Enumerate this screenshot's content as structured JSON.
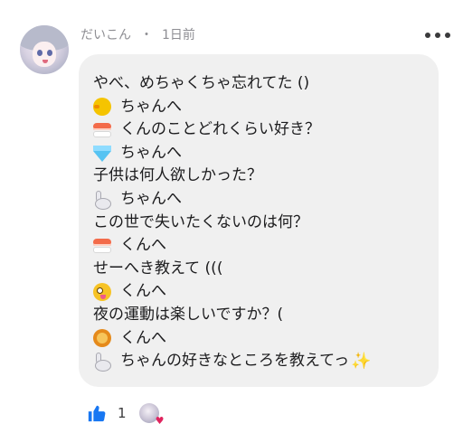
{
  "comment": {
    "author": "だいこん",
    "separator": "・",
    "timestamp": "1日前",
    "lines": [
      {
        "icon": "",
        "text": "やべ、めちゃくちゃ忘れてた ()"
      },
      {
        "icon": "chick-icon",
        "text": "ちゃんへ"
      },
      {
        "icon": "sushi-icon",
        "text": "くんのことどれくらい好き？"
      },
      {
        "icon": "gem-icon",
        "text": "ちゃんへ"
      },
      {
        "icon": "",
        "text": "子供は何人欲しかった？"
      },
      {
        "icon": "rabbit-icon",
        "text": "ちゃんへ"
      },
      {
        "icon": "",
        "text": "この世で失いたくないのは何？"
      },
      {
        "icon": "sushi-icon",
        "text": "くんへ"
      },
      {
        "icon": "",
        "text": "せーへき教えて (((",
        "note": ""
      },
      {
        "icon": "zany-face-icon",
        "text": "くんへ"
      },
      {
        "icon": "",
        "text": "夜の運動は楽しいですか？("
      },
      {
        "icon": "lion-icon",
        "text": "くんへ"
      },
      {
        "icon": "rabbit-icon",
        "text": "ちゃんの好きなところを教えてっ",
        "suffix": "✨"
      }
    ]
  },
  "reactions": {
    "like_count": "1",
    "liker_badge": "♥"
  },
  "menu": {
    "icon": "more-options-icon"
  }
}
